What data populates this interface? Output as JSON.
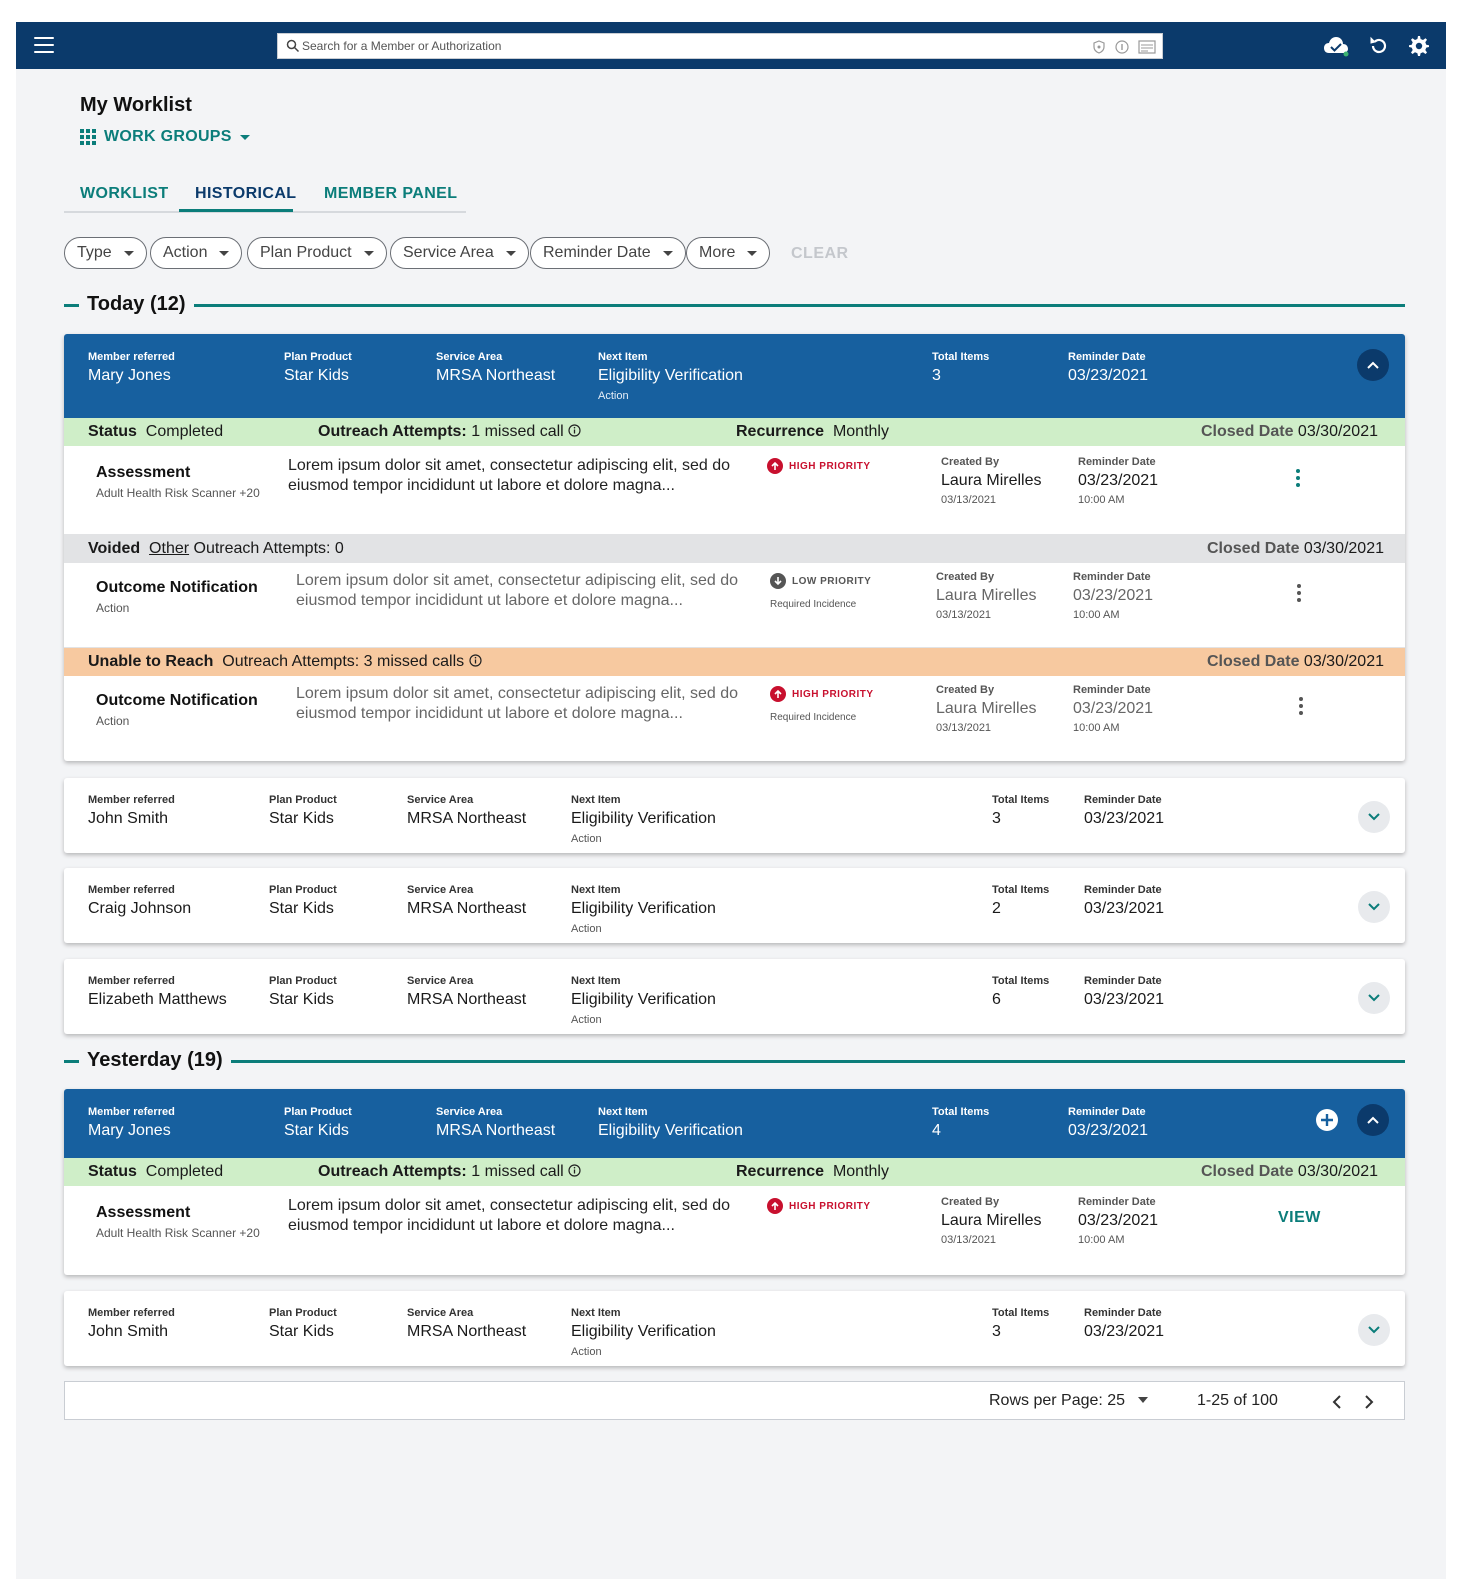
{
  "topbar": {
    "search_placeholder": "Search for a Member or Authorization",
    "icons": [
      "menu-icon",
      "search-icon",
      "shield-icon",
      "info-icon",
      "card-icon",
      "cloud-check-icon",
      "refresh-icon",
      "gear-icon"
    ]
  },
  "page": {
    "title": "My Worklist",
    "workgroups_label": "WORK GROUPS"
  },
  "tabs": [
    {
      "label": "WORKLIST",
      "active": false
    },
    {
      "label": "HISTORICAL",
      "active": true
    },
    {
      "label": "MEMBER PANEL",
      "active": false
    }
  ],
  "filters": {
    "chips": [
      "Type",
      "Action",
      "Plan Product",
      "Service Area",
      "Reminder Date",
      "More"
    ],
    "clear_label": "CLEAR"
  },
  "labels": {
    "member_referred": "Member referred",
    "plan_product": "Plan Product",
    "service_area": "Service Area",
    "next_item": "Next Item",
    "total_items": "Total Items",
    "reminder_date": "Reminder Date",
    "created_by": "Created By",
    "status": "Status",
    "outreach_attempts": "Outreach Attempts:",
    "recurrence": "Recurrence",
    "closed_date": "Closed Date"
  },
  "sections": [
    {
      "title": "Today (12)",
      "open_card": {
        "member": "Mary Jones",
        "plan": "Star Kids",
        "service_area": "MRSA Northeast",
        "next_item": "Eligibility Verification",
        "next_item_sub": "Action",
        "total_items": "3",
        "reminder_date": "03/23/2021",
        "groups": [
          {
            "status_bar": {
              "status": "Completed",
              "outreach": "1 missed call",
              "recurrence": "Monthly",
              "closed_date": "03/30/2021"
            },
            "item": {
              "title": "Assessment",
              "sub": "Adult Health Risk Scanner +20",
              "desc": "Lorem ipsum dolor sit amet, consectetur adipiscing elit, sed do eiusmod tempor incididunt ut labore et dolore magna...",
              "priority": "HIGH PRIORITY",
              "created_by": "Laura Mirelles",
              "created_date": "03/13/2021",
              "reminder_date": "03/23/2021",
              "reminder_time": "10:00 AM"
            }
          },
          {
            "status_bar": {
              "status": "Voided",
              "link": "Other",
              "outreach": "Outreach Attempts: 0",
              "closed_date": "03/30/2021"
            },
            "item": {
              "title": "Outcome Notification",
              "sub": "Action",
              "desc": "Lorem ipsum dolor sit amet, consectetur adipiscing elit, sed do eiusmod tempor incididunt ut labore et dolore magna...",
              "priority": "LOW PRIORITY",
              "required": "Required Incidence",
              "created_by": "Laura Mirelles",
              "created_date": "03/13/2021",
              "reminder_date": "03/23/2021",
              "reminder_time": "10:00 AM"
            }
          },
          {
            "status_bar": {
              "status": "Unable to Reach",
              "outreach": "Outreach Attempts: 3 missed calls",
              "closed_date": "03/30/2021"
            },
            "item": {
              "title": "Outcome Notification",
              "sub": "Action",
              "desc": "Lorem ipsum dolor sit amet, consectetur adipiscing elit, sed do eiusmod tempor incididunt ut labore et dolore magna...",
              "priority": "HIGH PRIORITY",
              "required": "Required Incidence",
              "created_by": "Laura Mirelles",
              "created_date": "03/13/2021",
              "reminder_date": "03/23/2021",
              "reminder_time": "10:00 AM"
            }
          }
        ]
      },
      "closed_cards": [
        {
          "member": "John Smith",
          "plan": "Star Kids",
          "service_area": "MRSA Northeast",
          "next_item": "Eligibility Verification",
          "next_item_sub": "Action",
          "total_items": "3",
          "reminder_date": "03/23/2021"
        },
        {
          "member": "Craig Johnson",
          "plan": "Star Kids",
          "service_area": "MRSA Northeast",
          "next_item": "Eligibility Verification",
          "next_item_sub": "Action",
          "total_items": "2",
          "reminder_date": "03/23/2021"
        },
        {
          "member": "Elizabeth Matthews",
          "plan": "Star Kids",
          "service_area": "MRSA Northeast",
          "next_item": "Eligibility Verification",
          "next_item_sub": "Action",
          "total_items": "6",
          "reminder_date": "03/23/2021"
        }
      ]
    },
    {
      "title": "Yesterday (19)",
      "open_card": {
        "member": "Mary Jones",
        "plan": "Star Kids",
        "service_area": "MRSA Northeast",
        "next_item": "Eligibility Verification",
        "total_items": "4",
        "reminder_date": "03/23/2021",
        "status_bar": {
          "status": "Completed",
          "outreach": "1 missed call",
          "recurrence": "Monthly",
          "closed_date": "03/30/2021"
        },
        "item": {
          "title": "Assessment",
          "sub": "Adult Health Risk Scanner +20",
          "desc": "Lorem ipsum dolor sit amet, consectetur adipiscing elit, sed do eiusmod tempor incididunt ut labore et dolore magna...",
          "priority": "HIGH PRIORITY",
          "created_by": "Laura Mirelles",
          "created_date": "03/13/2021",
          "reminder_date": "03/23/2021",
          "reminder_time": "10:00 AM",
          "action_label": "VIEW"
        }
      },
      "closed_cards": [
        {
          "member": "John Smith",
          "plan": "Star Kids",
          "service_area": "MRSA Northeast",
          "next_item": "Eligibility Verification",
          "next_item_sub": "Action",
          "total_items": "3",
          "reminder_date": "03/23/2021"
        }
      ]
    }
  ],
  "pagination": {
    "rows_per_page": "Rows per Page: 25",
    "range": "1-25 of 100"
  },
  "colors": {
    "navy": "#0b3a6b",
    "card_header_blue": "#17609f",
    "teal": "#0b7d7a",
    "status_green": "#cfeec8",
    "status_grey": "#e2e3e5",
    "status_orange": "#f7c9a0",
    "high_priority_red": "#c8102e"
  }
}
